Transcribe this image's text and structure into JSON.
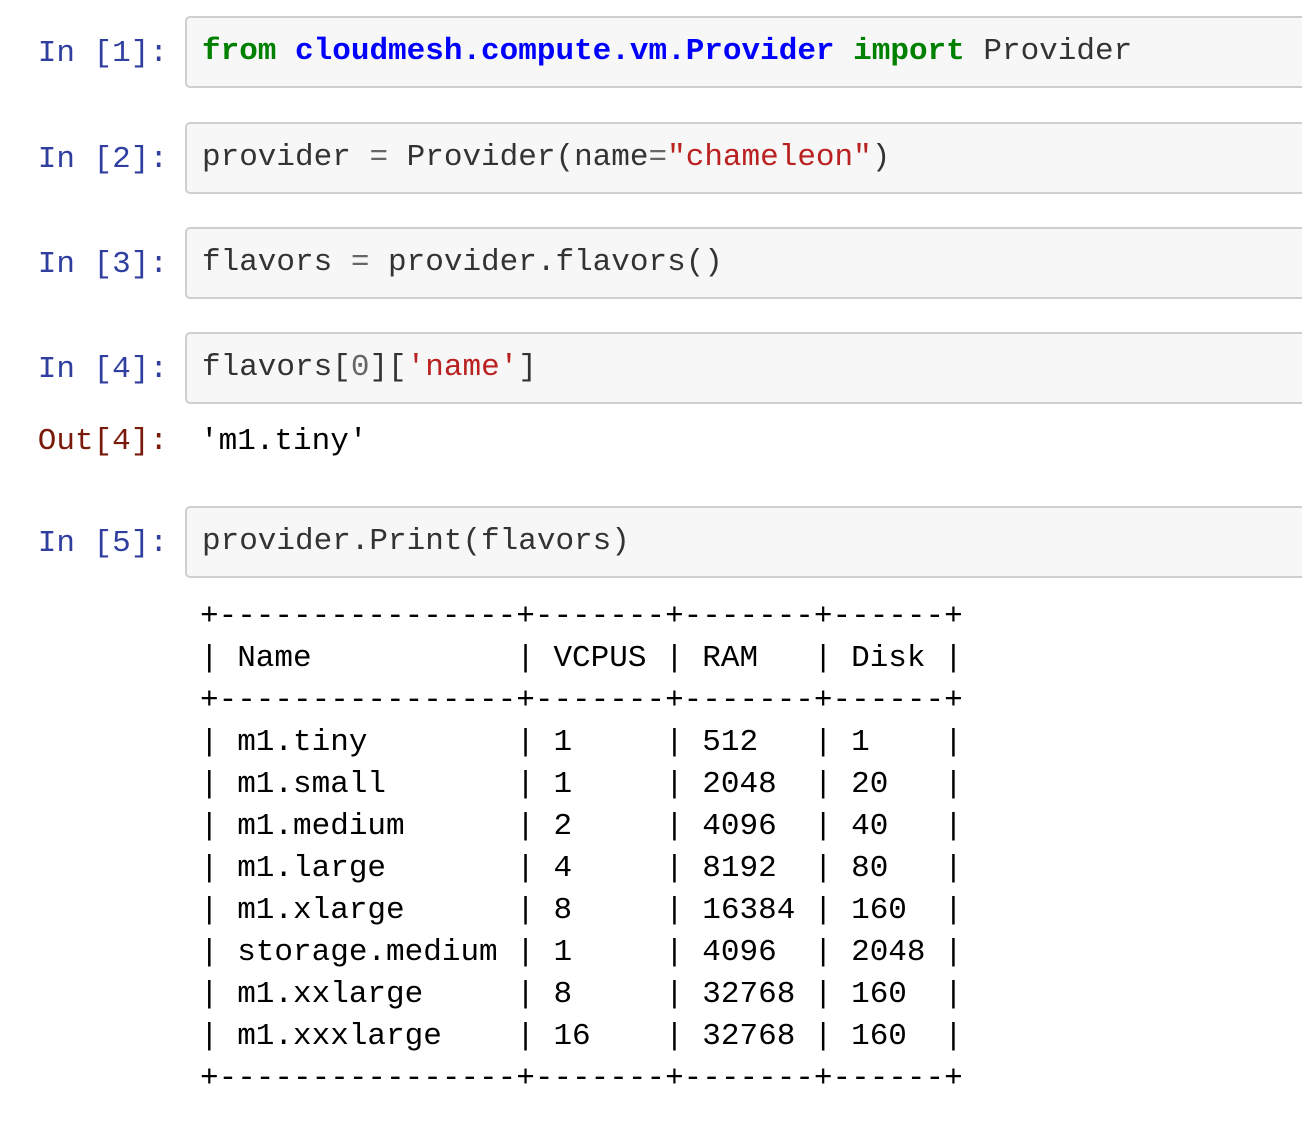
{
  "cells": [
    {
      "prompt": "In [1]:",
      "tokens": [
        {
          "t": "from",
          "c": "kw"
        },
        {
          "t": " ",
          "c": ""
        },
        {
          "t": "cloudmesh.compute.vm.Provider",
          "c": "mod"
        },
        {
          "t": " ",
          "c": ""
        },
        {
          "t": "import",
          "c": "kw"
        },
        {
          "t": " Provider",
          "c": ""
        }
      ]
    },
    {
      "prompt": "In [2]:",
      "tokens": [
        {
          "t": "provider ",
          "c": ""
        },
        {
          "t": "=",
          "c": "op"
        },
        {
          "t": " Provider(name",
          "c": ""
        },
        {
          "t": "=",
          "c": "op"
        },
        {
          "t": "\"chameleon\"",
          "c": "str"
        },
        {
          "t": ")",
          "c": ""
        }
      ]
    },
    {
      "prompt": "In [3]:",
      "tokens": [
        {
          "t": "flavors ",
          "c": ""
        },
        {
          "t": "=",
          "c": "op"
        },
        {
          "t": " provider.flavors()",
          "c": ""
        }
      ]
    },
    {
      "prompt": "In [4]:",
      "tokens": [
        {
          "t": "flavors[",
          "c": ""
        },
        {
          "t": "0",
          "c": "num"
        },
        {
          "t": "][",
          "c": ""
        },
        {
          "t": "'name'",
          "c": "str"
        },
        {
          "t": "]",
          "c": ""
        }
      ]
    },
    {
      "prompt": "In [5]:",
      "tokens": [
        {
          "t": "provider.Print(flavors)",
          "c": ""
        }
      ]
    }
  ],
  "outputs": {
    "out4": {
      "prompt": "Out[4]:",
      "text": "'m1.tiny'"
    }
  },
  "flavor_table": {
    "border": "+----------------+-------+-------+------+",
    "columns": [
      "Name",
      "VCPUS",
      "RAM",
      "Disk"
    ],
    "widths": [
      14,
      5,
      5,
      4
    ],
    "rows": [
      [
        "m1.tiny",
        "1",
        "512",
        "1"
      ],
      [
        "m1.small",
        "1",
        "2048",
        "20"
      ],
      [
        "m1.medium",
        "2",
        "4096",
        "40"
      ],
      [
        "m1.large",
        "4",
        "8192",
        "80"
      ],
      [
        "m1.xlarge",
        "8",
        "16384",
        "160"
      ],
      [
        "storage.medium",
        "1",
        "4096",
        "2048"
      ],
      [
        "m1.xxlarge",
        "8",
        "32768",
        "160"
      ],
      [
        "m1.xxxlarge",
        "16",
        "32768",
        "160"
      ]
    ]
  }
}
